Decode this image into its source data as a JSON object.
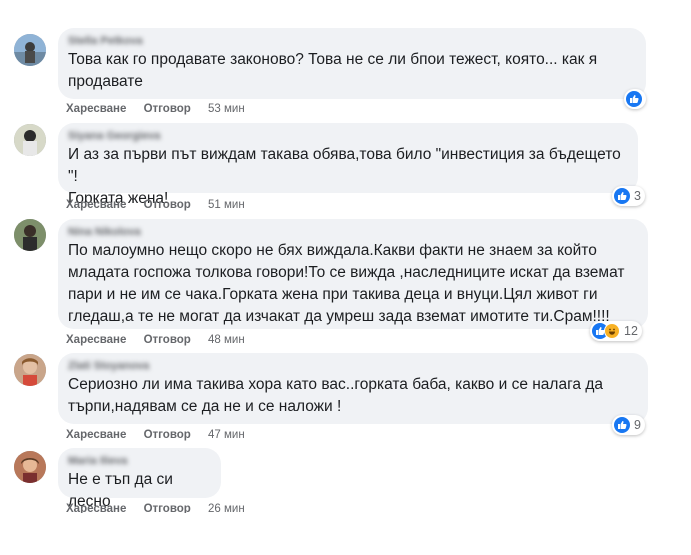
{
  "comments": [
    {
      "author": "Stella Petkova",
      "text": "Това как го продавате законово? Това не се ли бпои тежест, която... как я продавате",
      "like": "Харесване",
      "reply": "Отговор",
      "time": "53 мин",
      "reactions": {
        "icons": [
          "like-icon"
        ],
        "count": ""
      }
    },
    {
      "author": "Siyana Georgieva",
      "text": "И аз за първи път виждам такава обява,това било \"инвестиция за бъдещето \"!\nГорката жена!",
      "like": "Харесване",
      "reply": "Отговор",
      "time": "51 мин",
      "reactions": {
        "icons": [
          "like-icon"
        ],
        "count": "3"
      }
    },
    {
      "author": "Nina Nikolova",
      "text": "По малоумно нещо скоро не бях виждала.Какви факти не знаем за който\nмладата госпожа толкова говори!То се вижда ,наследниците искат да вземат\nпари и не им се чака.Горката жена при такива деца и внуци.Цял живот ги\nгледаш,а те не могат да изчакат да умреш зада вземат имотите ти.Срам!!!!",
      "like": "Харесване",
      "reply": "Отговор",
      "time": "48 мин",
      "reactions": {
        "icons": [
          "like-icon",
          "haha-icon"
        ],
        "count": "12"
      }
    },
    {
      "author": "Zlati Stoyanova",
      "text": "Сериозно ли има такива хора като вас..горката баба, какво и се налага да\nтърпи,надявам се да не и се наложи !",
      "like": "Харесване",
      "reply": "Отговор",
      "time": "47 мин",
      "reactions": {
        "icons": [
          "like-icon"
        ],
        "count": "9"
      }
    },
    {
      "author": "Maria Ilieva",
      "text": "Не е тъп да си лесно",
      "like": "Харесване",
      "reply": "Отговор",
      "time": "26 мин",
      "reactions": null
    }
  ],
  "colors": {
    "like_blue": "#1877f2",
    "bubble_gray": "#f0f2f5",
    "meta_gray": "#65676b",
    "haha_yellow": "#f7b125"
  }
}
